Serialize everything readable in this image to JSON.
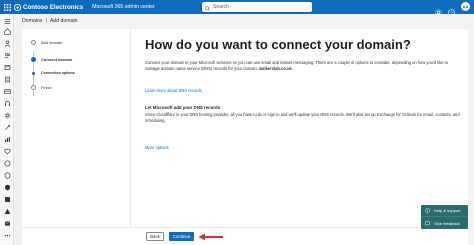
{
  "topbar": {
    "brand": "Contoso Electronics",
    "app_name": "Microsoft 365 admin center",
    "search_placeholder": "Search",
    "avatar_initials": "AA"
  },
  "breadcrumb": {
    "items": [
      "Domains",
      "Add domain"
    ],
    "separator": "|"
  },
  "steps": [
    {
      "label": "Add domain",
      "state": "done"
    },
    {
      "label": "Connect domain",
      "state": "current"
    },
    {
      "label": "Connection options",
      "state": "substep"
    },
    {
      "label": "Finish",
      "state": "pending"
    }
  ],
  "main": {
    "title": "How do you want to connect your domain?",
    "description": "Connect your domain to your Microsoft services so you can use email and instant messaging. There are a couple of options to consider, depending on how you'd like to manage domain name service (DNS) records for your domain:",
    "domain_name": "walkerslab.co.uk",
    "learn_more": "Learn more about DNS records",
    "option_title": "Let Microsoft add your DNS records",
    "option_desc": "Since Cloudflare is your DNS hosting provider, all you have to do is sign in and we'll update your DNS records. We'll also set up Exchange for Outlook for email, contacts, and scheduling.",
    "more_options": "More options"
  },
  "footer": {
    "back_label": "Back",
    "continue_label": "Continue"
  },
  "help_panel": {
    "help_label": "Help & support",
    "feedback_label": "Give feedback"
  },
  "colors": {
    "brand_blue": "#0f6cbd",
    "help_panel": "#2b6b6b",
    "annotation_arrow": "#d13438"
  }
}
